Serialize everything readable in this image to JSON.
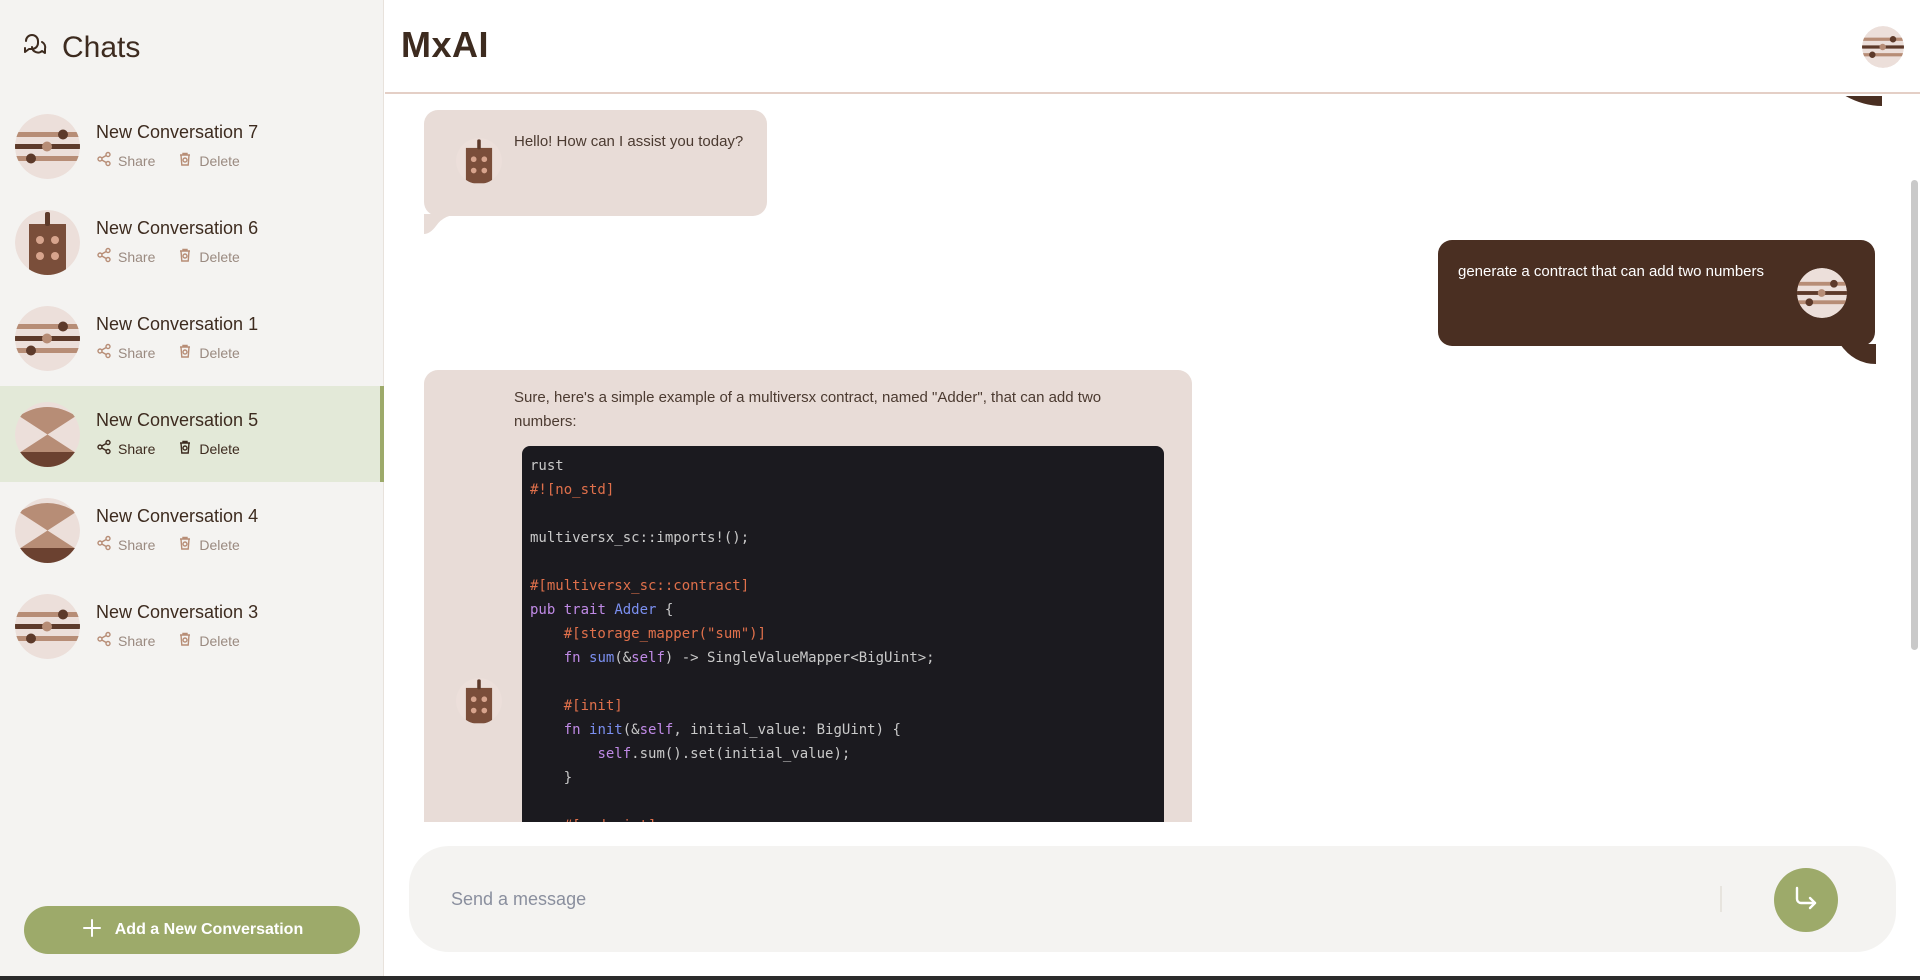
{
  "sidebar": {
    "title": "Chats",
    "items": [
      {
        "label": "New Conversation 7",
        "share": "Share",
        "delete": "Delete",
        "avatar": "sliders"
      },
      {
        "label": "New Conversation 6",
        "share": "Share",
        "delete": "Delete",
        "avatar": "robot"
      },
      {
        "label": "New Conversation 1",
        "share": "Share",
        "delete": "Delete",
        "avatar": "sliders"
      },
      {
        "label": "New Conversation 5",
        "share": "Share",
        "delete": "Delete",
        "avatar": "hourglass",
        "active": true
      },
      {
        "label": "New Conversation 4",
        "share": "Share",
        "delete": "Delete",
        "avatar": "hourglass"
      },
      {
        "label": "New Conversation 3",
        "share": "Share",
        "delete": "Delete",
        "avatar": "sliders"
      }
    ],
    "add_button": "Add a New Conversation"
  },
  "header": {
    "brand": "MxAI"
  },
  "messages": {
    "greeting": "Hello! How can I assist you today?",
    "user_prompt": "generate a contract that can add two numbers",
    "reply_intro": "Sure, here's a simple example of a multiversx contract, named \"Adder\", that can add two numbers:"
  },
  "code": {
    "language": "rust",
    "lines": [
      "rust",
      "#![no_std]",
      "",
      "multiversx_sc::imports!();",
      "",
      "#[multiversx_sc::contract]",
      "pub trait Adder {",
      "    #[storage_mapper(\"sum\")]",
      "    fn sum(&self) -> SingleValueMapper<BigUint>;",
      "",
      "    #[init]",
      "    fn init(&self, initial_value: BigUint) {",
      "        self.sum().set(initial_value);",
      "    }",
      "",
      "    #[endpoint]"
    ]
  },
  "composer": {
    "placeholder": "Send a message"
  },
  "colors": {
    "accent": "#9daa6a",
    "user_bubble": "#4a2f22",
    "ai_bubble": "#e8dcd7",
    "active_item": "#e3e9d8"
  }
}
